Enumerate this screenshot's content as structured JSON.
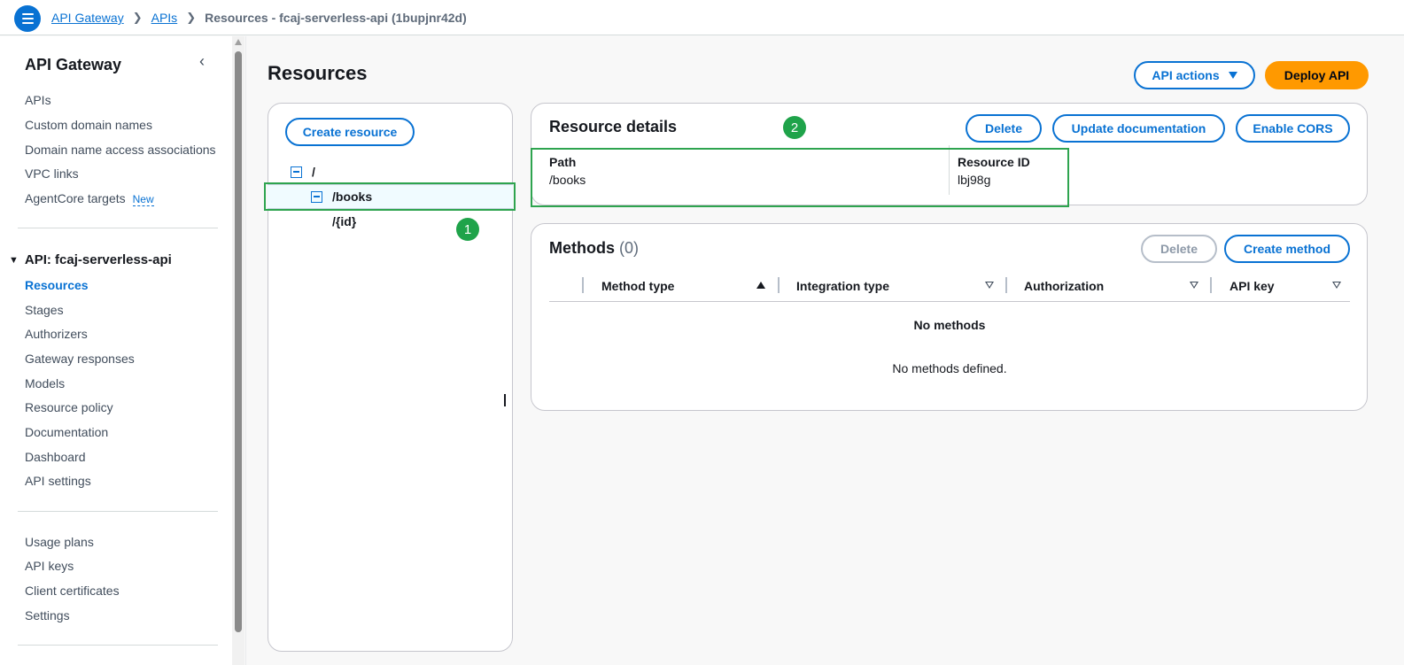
{
  "breadcrumb": {
    "items": [
      "API Gateway",
      "APIs"
    ],
    "current": "Resources - fcaj-serverless-api (1bupjnr42d)"
  },
  "sidebar": {
    "title": "API Gateway",
    "top_items": [
      "APIs",
      "Custom domain names",
      "Domain name access associations",
      "VPC links",
      "AgentCore targets"
    ],
    "new_badge": "New",
    "api_section": "API: fcaj-serverless-api",
    "api_items": [
      "Resources",
      "Stages",
      "Authorizers",
      "Gateway responses",
      "Models",
      "Resource policy",
      "Documentation",
      "Dashboard",
      "API settings"
    ],
    "bottom_items": [
      "Usage plans",
      "API keys",
      "Client certificates",
      "Settings"
    ]
  },
  "page": {
    "title": "Resources",
    "api_actions_label": "API actions",
    "deploy_label": "Deploy API"
  },
  "tree": {
    "create_label": "Create resource",
    "nodes": [
      "/",
      "/books",
      "/{id}"
    ]
  },
  "details": {
    "title": "Resource details",
    "delete_label": "Delete",
    "update_doc_label": "Update documentation",
    "cors_label": "Enable CORS",
    "path_label": "Path",
    "path_value": "/books",
    "id_label": "Resource ID",
    "id_value": "lbj98g"
  },
  "methods": {
    "title": "Methods",
    "count": "(0)",
    "delete_label": "Delete",
    "create_label": "Create method",
    "columns": [
      "Method type",
      "Integration type",
      "Authorization",
      "API key"
    ],
    "empty_title": "No methods",
    "empty_sub": "No methods defined."
  },
  "annotations": [
    "1",
    "2"
  ],
  "colors": {
    "accent": "#0972d3",
    "primary_button": "#ff9900",
    "annotation_green": "#2ea44f"
  }
}
